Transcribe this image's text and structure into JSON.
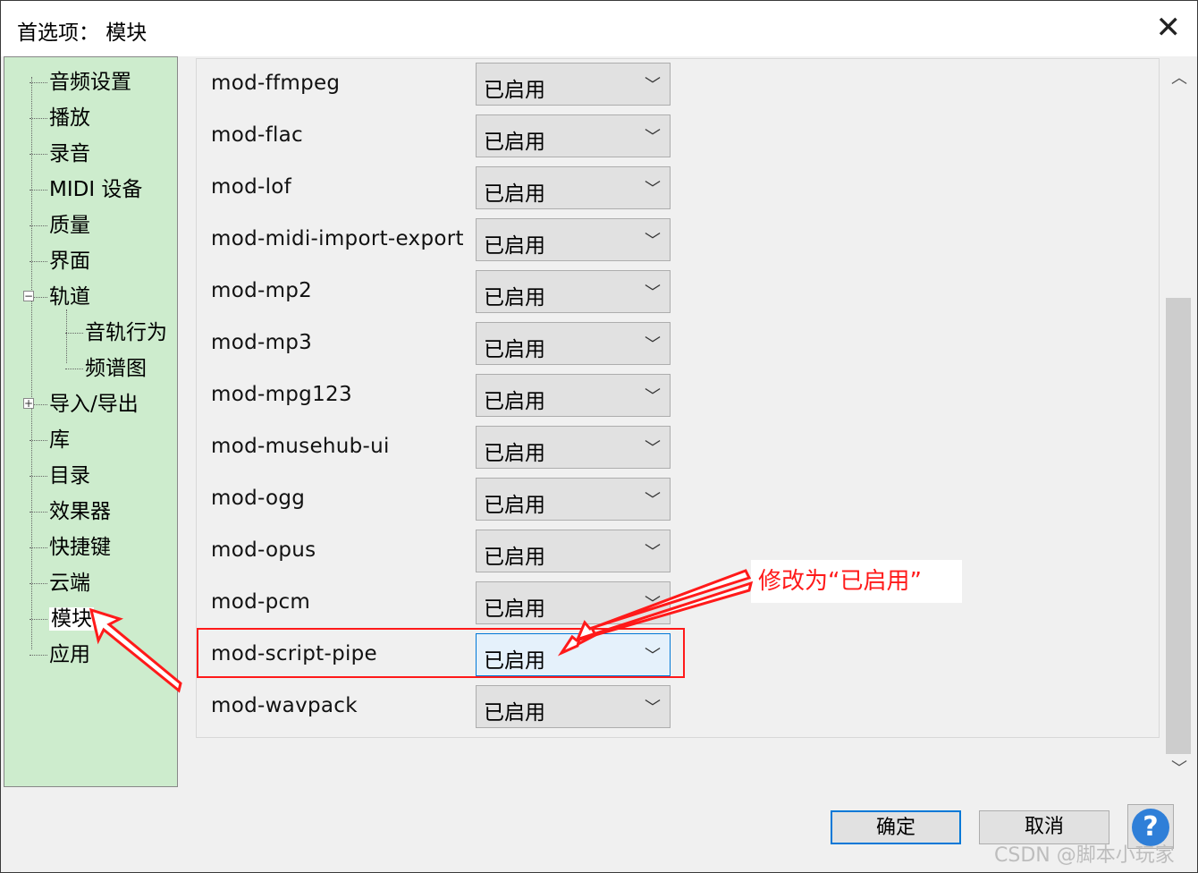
{
  "window": {
    "title": "首选项：  模块",
    "close_symbol": "✕"
  },
  "tree": {
    "items": [
      {
        "label": "音频设置"
      },
      {
        "label": "播放"
      },
      {
        "label": "录音"
      },
      {
        "label": "MIDI 设备"
      },
      {
        "label": "质量"
      },
      {
        "label": "界面"
      },
      {
        "label": "轨道",
        "expander": "−"
      },
      {
        "label": "音轨行为"
      },
      {
        "label": "频谱图"
      },
      {
        "label": "导入/导出",
        "expander": "+"
      },
      {
        "label": "库"
      },
      {
        "label": "目录"
      },
      {
        "label": "效果器"
      },
      {
        "label": "快捷键"
      },
      {
        "label": "云端"
      },
      {
        "label": "模块",
        "selected": true
      },
      {
        "label": "应用"
      }
    ]
  },
  "modules": [
    {
      "name": "mod-ffmpeg",
      "status": "已启用"
    },
    {
      "name": "mod-flac",
      "status": "已启用"
    },
    {
      "name": "mod-lof",
      "status": "已启用"
    },
    {
      "name": "mod-midi-import-export",
      "status": "已启用"
    },
    {
      "name": "mod-mp2",
      "status": "已启用"
    },
    {
      "name": "mod-mp3",
      "status": "已启用"
    },
    {
      "name": "mod-mpg123",
      "status": "已启用"
    },
    {
      "name": "mod-musehub-ui",
      "status": "已启用"
    },
    {
      "name": "mod-ogg",
      "status": "已启用"
    },
    {
      "name": "mod-opus",
      "status": "已启用"
    },
    {
      "name": "mod-pcm",
      "status": "已启用"
    },
    {
      "name": "mod-script-pipe",
      "status": "已启用",
      "active": true
    },
    {
      "name": "mod-wavpack",
      "status": "已启用"
    }
  ],
  "dropdown_chevron": "﹀",
  "scrollbar": {
    "up": "︿",
    "down": "﹀"
  },
  "buttons": {
    "ok": "确定",
    "cancel": "取消",
    "help": "?"
  },
  "annotation": {
    "text": "修改为“已启用”",
    "color": "#ff1a1a"
  },
  "watermark": "CSDN @脚本小玩家"
}
